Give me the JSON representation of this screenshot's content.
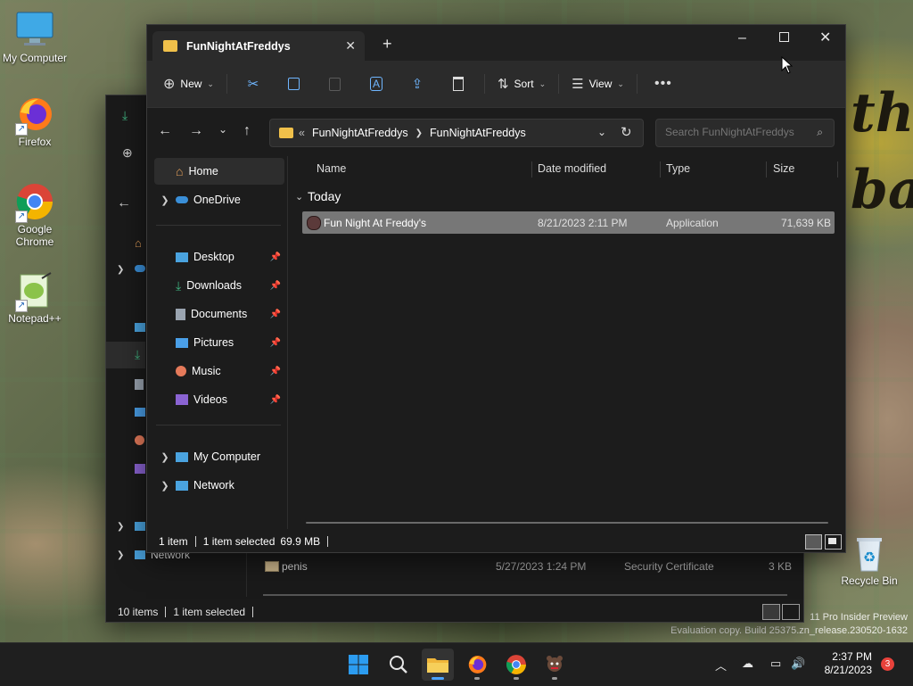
{
  "desktop": {
    "icons": [
      {
        "label": "My Computer"
      },
      {
        "label": "Firefox"
      },
      {
        "label": "Google Chrome"
      },
      {
        "label": "Notepad++"
      },
      {
        "label": "Recycle Bin"
      }
    ],
    "watermark_line1": "11 Pro Insider Preview",
    "watermark_line2": "Evaluation copy. Build 25375.zn_release.230520-1632"
  },
  "back_window": {
    "nav_label_network": "Network",
    "file": {
      "name": "penis",
      "date": "5/27/2023 1:24 PM",
      "type": "Security Certificate",
      "size": "3 KB"
    },
    "status": {
      "count": "10 items",
      "selected": "1 item selected"
    }
  },
  "window": {
    "tab_title": "FunNightAtFreddys",
    "new_tab_symbol": "+",
    "toolbar": {
      "new_label": "New",
      "sort_label": "Sort",
      "view_label": "View"
    },
    "breadcrumb": {
      "overflow": "«",
      "segments": [
        "FunNightAtFreddys",
        "FunNightAtFreddys"
      ]
    },
    "search": {
      "placeholder": "Search FunNightAtFreddys"
    },
    "nav": {
      "home": "Home",
      "onedrive": "OneDrive",
      "quick_access": [
        {
          "label": "Desktop",
          "color": "#4aa3df"
        },
        {
          "label": "Downloads",
          "color": "#3fb27f"
        },
        {
          "label": "Documents",
          "color": "#9aa4b0"
        },
        {
          "label": "Pictures",
          "color": "#4a9fe8"
        },
        {
          "label": "Music",
          "color": "#e57a5a"
        },
        {
          "label": "Videos",
          "color": "#8a63d2"
        }
      ],
      "my_computer": "My Computer",
      "network": "Network"
    },
    "columns": {
      "name": "Name",
      "date": "Date modified",
      "type": "Type",
      "size": "Size"
    },
    "group_label": "Today",
    "files": [
      {
        "name": "Fun Night At Freddy's",
        "date": "8/21/2023 2:11 PM",
        "type": "Application",
        "size": "71,639 KB",
        "selected": true
      }
    ],
    "status": {
      "count": "1 item",
      "selected": "1 item selected",
      "selected_size": "69.9 MB"
    }
  },
  "taskbar": {
    "time": "2:37 PM",
    "date": "8/21/2023",
    "notification_count": "3",
    "colors": {
      "accent": "#0078d4",
      "selection": "#777777",
      "badge": "#e8423b"
    }
  }
}
